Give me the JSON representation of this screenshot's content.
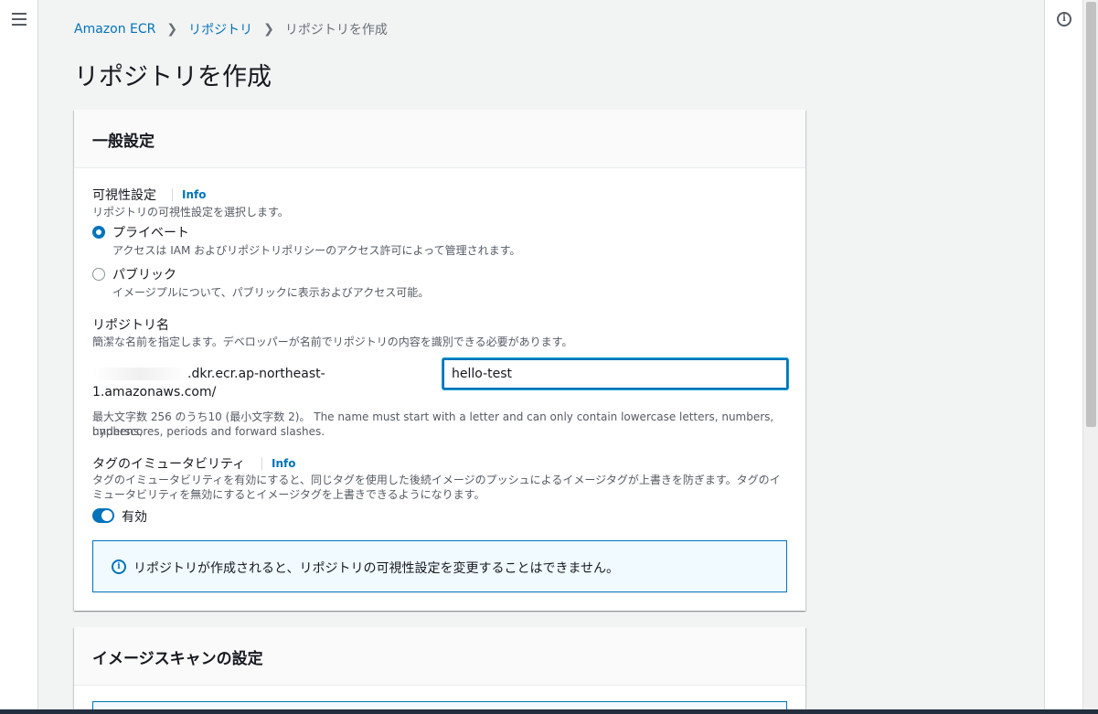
{
  "breadcrumb": {
    "items": [
      "Amazon ECR",
      "リポジトリ"
    ],
    "current": "リポジトリを作成"
  },
  "page": {
    "title": "リポジトリを作成"
  },
  "general": {
    "header": "一般設定",
    "visibility": {
      "label": "可視性設定",
      "info": "Info",
      "description": "リポジトリの可視性設定を選択します。",
      "options": [
        {
          "label": "プライベート",
          "description": "アクセスは IAM およびリポジトリポリシーのアクセス許可によって管理されます。",
          "selected": true
        },
        {
          "label": "パブリック",
          "description": "イメージプルについて、パブリックに表示およびアクセス可能。",
          "selected": false
        }
      ]
    },
    "repo_name": {
      "label": "リポジトリ名",
      "description": "簡潔な名前を指定します。デベロッパーが名前でリポジトリの内容を識別できる必要があります。",
      "uri_prefix_line1": ".dkr.ecr.ap-northeast-",
      "uri_prefix_line2": "1.amazonaws.com/",
      "value": "hello-test",
      "constraint_line1": "最大文字数 256 のうち10 (最小文字数 2)。 The name must start with a letter and can only contain lowercase letters, numbers, hyphens,",
      "constraint_line2": "underscores, periods and forward slashes."
    },
    "immutability": {
      "label": "タグのイミュータビリティ",
      "info": "Info",
      "description_line1": "タグのイミュータビリティを有効にすると、同じタグを使用した後続イメージのプッシュによるイメージタグが上書きを防ぎます。タグのイ",
      "description_line2": "ミュータビリティを無効にするとイメージタグを上書きできるようになります。",
      "toggle_label": "有効",
      "enabled": true
    },
    "alert": "リポジトリが作成されると、リポジトリの可視性設定を変更することはできません。"
  },
  "scan": {
    "header": "イメージスキャンの設定"
  },
  "colors": {
    "accent": "#0073bb",
    "background": "#f2f3f3"
  },
  "icons": {
    "menu": "hamburger-icon",
    "info": "info-circle-icon"
  }
}
